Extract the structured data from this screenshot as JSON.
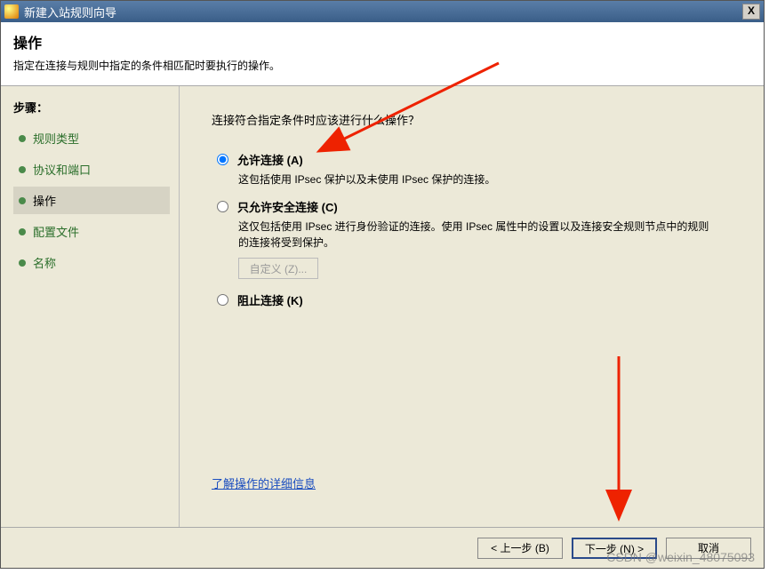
{
  "titlebar": {
    "title": "新建入站规则向导",
    "close_glyph": "X"
  },
  "header": {
    "title": "操作",
    "description": "指定在连接与规则中指定的条件相匹配时要执行的操作。"
  },
  "sidebar": {
    "steps_label": "步骤：",
    "items": [
      {
        "label": "规则类型",
        "active": false
      },
      {
        "label": "协议和端口",
        "active": false
      },
      {
        "label": "操作",
        "active": true
      },
      {
        "label": "配置文件",
        "active": false
      },
      {
        "label": "名称",
        "active": false
      }
    ]
  },
  "main": {
    "question": "连接符合指定条件时应该进行什么操作？",
    "options": {
      "allow": {
        "label": "允许连接 (A)",
        "desc": "这包括使用 IPsec 保护以及未使用 IPsec 保护的连接。",
        "selected": true
      },
      "secure": {
        "label": "只允许安全连接 (C)",
        "desc": "这仅包括使用 IPsec 进行身份验证的连接。使用 IPsec 属性中的设置以及连接安全规则节点中的规则的连接将受到保护。",
        "selected": false
      },
      "block": {
        "label": "阻止连接 (K)",
        "selected": false
      }
    },
    "customize_btn": "自定义 (Z)...",
    "learn_more": "了解操作的详细信息"
  },
  "footer": {
    "back": "< 上一步 (B)",
    "next": "下一步 (N) >",
    "cancel": "取消"
  },
  "watermark": "CSDN @weixin_48075093"
}
